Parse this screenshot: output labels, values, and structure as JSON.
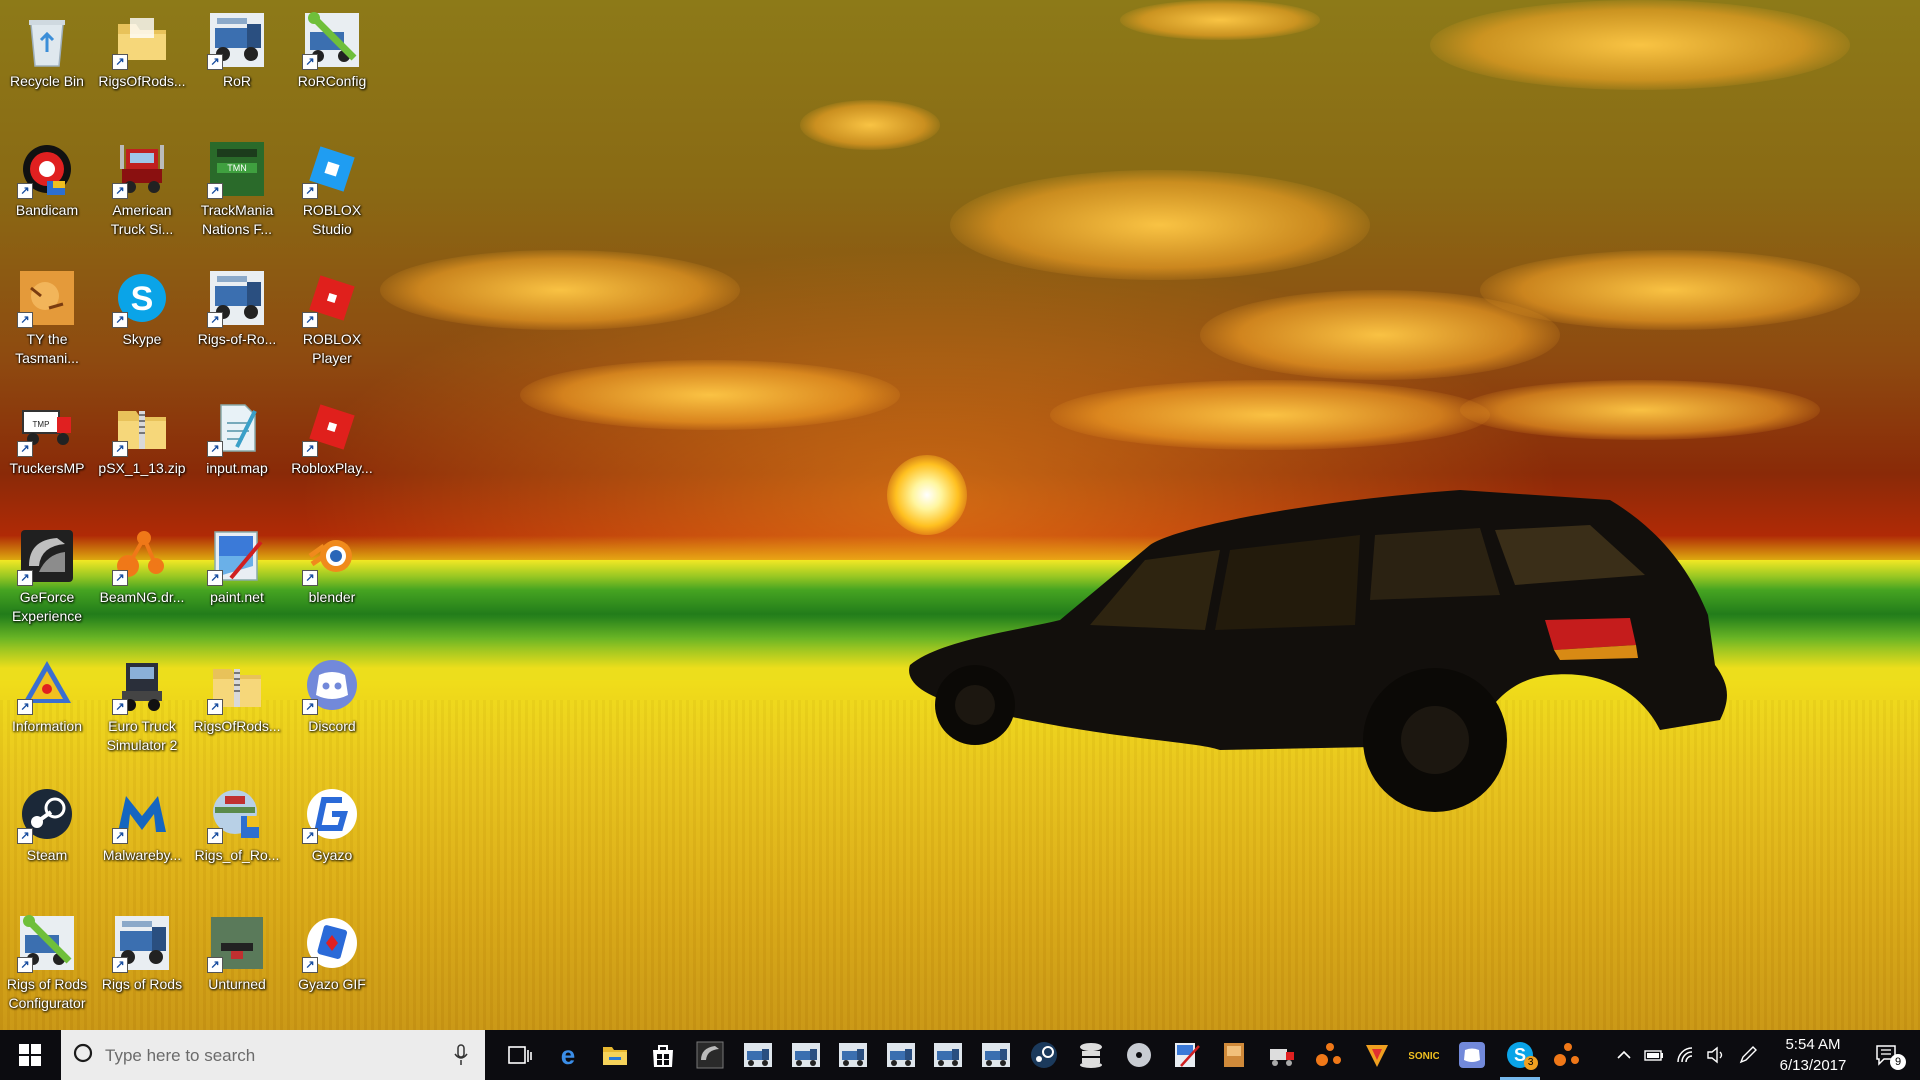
{
  "desktop": {
    "icons": [
      {
        "label": "Recycle Bin",
        "icon": "recycle-bin-icon"
      },
      {
        "label": "RigsOfRods...",
        "icon": "folder-icon"
      },
      {
        "label": "RoR",
        "icon": "rigs-of-rods-truck-icon"
      },
      {
        "label": "RoRConfig",
        "icon": "rorconfig-icon"
      },
      {
        "label": "Bandicam",
        "icon": "bandicam-icon"
      },
      {
        "label": "American Truck Si...",
        "icon": "american-truck-simulator-icon"
      },
      {
        "label": "TrackMania Nations F...",
        "icon": "trackmania-icon"
      },
      {
        "label": "ROBLOX Studio",
        "icon": "roblox-studio-icon"
      },
      {
        "label": "TY the Tasmani...",
        "icon": "ty-the-tasmanian-tiger-icon"
      },
      {
        "label": "Skype",
        "icon": "skype-icon"
      },
      {
        "label": "Rigs-of-Ro...",
        "icon": "rigs-of-rods-truck-icon"
      },
      {
        "label": "ROBLOX Player",
        "icon": "roblox-player-icon"
      },
      {
        "label": "TruckersMP",
        "icon": "truckersmp-icon"
      },
      {
        "label": "pSX_1_13.zip",
        "icon": "zip-folder-icon"
      },
      {
        "label": "input.map",
        "icon": "notepad-file-icon"
      },
      {
        "label": "RobloxPlay...",
        "icon": "roblox-player-icon"
      },
      {
        "label": "GeForce Experience",
        "icon": "geforce-experience-icon"
      },
      {
        "label": "BeamNG.dr...",
        "icon": "beamng-icon"
      },
      {
        "label": "paint.net",
        "icon": "paint-net-icon"
      },
      {
        "label": "blender",
        "icon": "blender-icon"
      },
      {
        "label": "Information",
        "icon": "information-icon"
      },
      {
        "label": "Euro Truck Simulator 2",
        "icon": "euro-truck-simulator-icon"
      },
      {
        "label": "RigsOfRods...",
        "icon": "zip-folder-icon"
      },
      {
        "label": "Discord",
        "icon": "discord-icon"
      },
      {
        "label": "Steam",
        "icon": "steam-icon"
      },
      {
        "label": "Malwareby...",
        "icon": "malwarebytes-icon"
      },
      {
        "label": "Rigs_of_Ro...",
        "icon": "rigs-of-rods-installer-icon"
      },
      {
        "label": "Gyazo",
        "icon": "gyazo-icon"
      },
      {
        "label": "Rigs of Rods Configurator",
        "icon": "rorconfig-icon"
      },
      {
        "label": "Rigs of Rods",
        "icon": "rigs-of-rods-truck-icon"
      },
      {
        "label": "Unturned",
        "icon": "unturned-icon"
      },
      {
        "label": "Gyazo GIF",
        "icon": "gyazo-gif-icon"
      }
    ]
  },
  "taskbar": {
    "search_placeholder": "Type here to search",
    "pinned": [
      {
        "icon": "task-view-icon"
      },
      {
        "icon": "edge-icon"
      },
      {
        "icon": "file-explorer-icon"
      },
      {
        "icon": "store-icon"
      },
      {
        "icon": "geforce-experience-icon"
      },
      {
        "icon": "rigs-of-rods-truck-icon"
      },
      {
        "icon": "rigs-of-rods-truck-icon"
      },
      {
        "icon": "rigs-of-rods-truck-icon"
      },
      {
        "icon": "rigs-of-rods-truck-icon"
      },
      {
        "icon": "rigs-of-rods-truck-icon"
      },
      {
        "icon": "rigs-of-rods-truck-icon"
      },
      {
        "icon": "steam-icon"
      },
      {
        "icon": "stack-icon"
      },
      {
        "icon": "disc-icon"
      },
      {
        "icon": "paint-net-icon"
      },
      {
        "icon": "game-box-icon"
      },
      {
        "icon": "truckersmp-icon"
      },
      {
        "icon": "beamng-icon"
      },
      {
        "icon": "arrow-app-icon"
      },
      {
        "icon": "sonic-icon"
      },
      {
        "icon": "discord-icon"
      },
      {
        "icon": "skype-icon",
        "badge": "3",
        "active": true
      },
      {
        "icon": "beamng-icon"
      }
    ],
    "clock": {
      "time": "5:54 AM",
      "date": "6/13/2017"
    },
    "notifications_count": "9"
  },
  "colors": {
    "taskbar": "#0c0c10",
    "accent": "#76b9ed",
    "search_bg": "#ececec"
  }
}
